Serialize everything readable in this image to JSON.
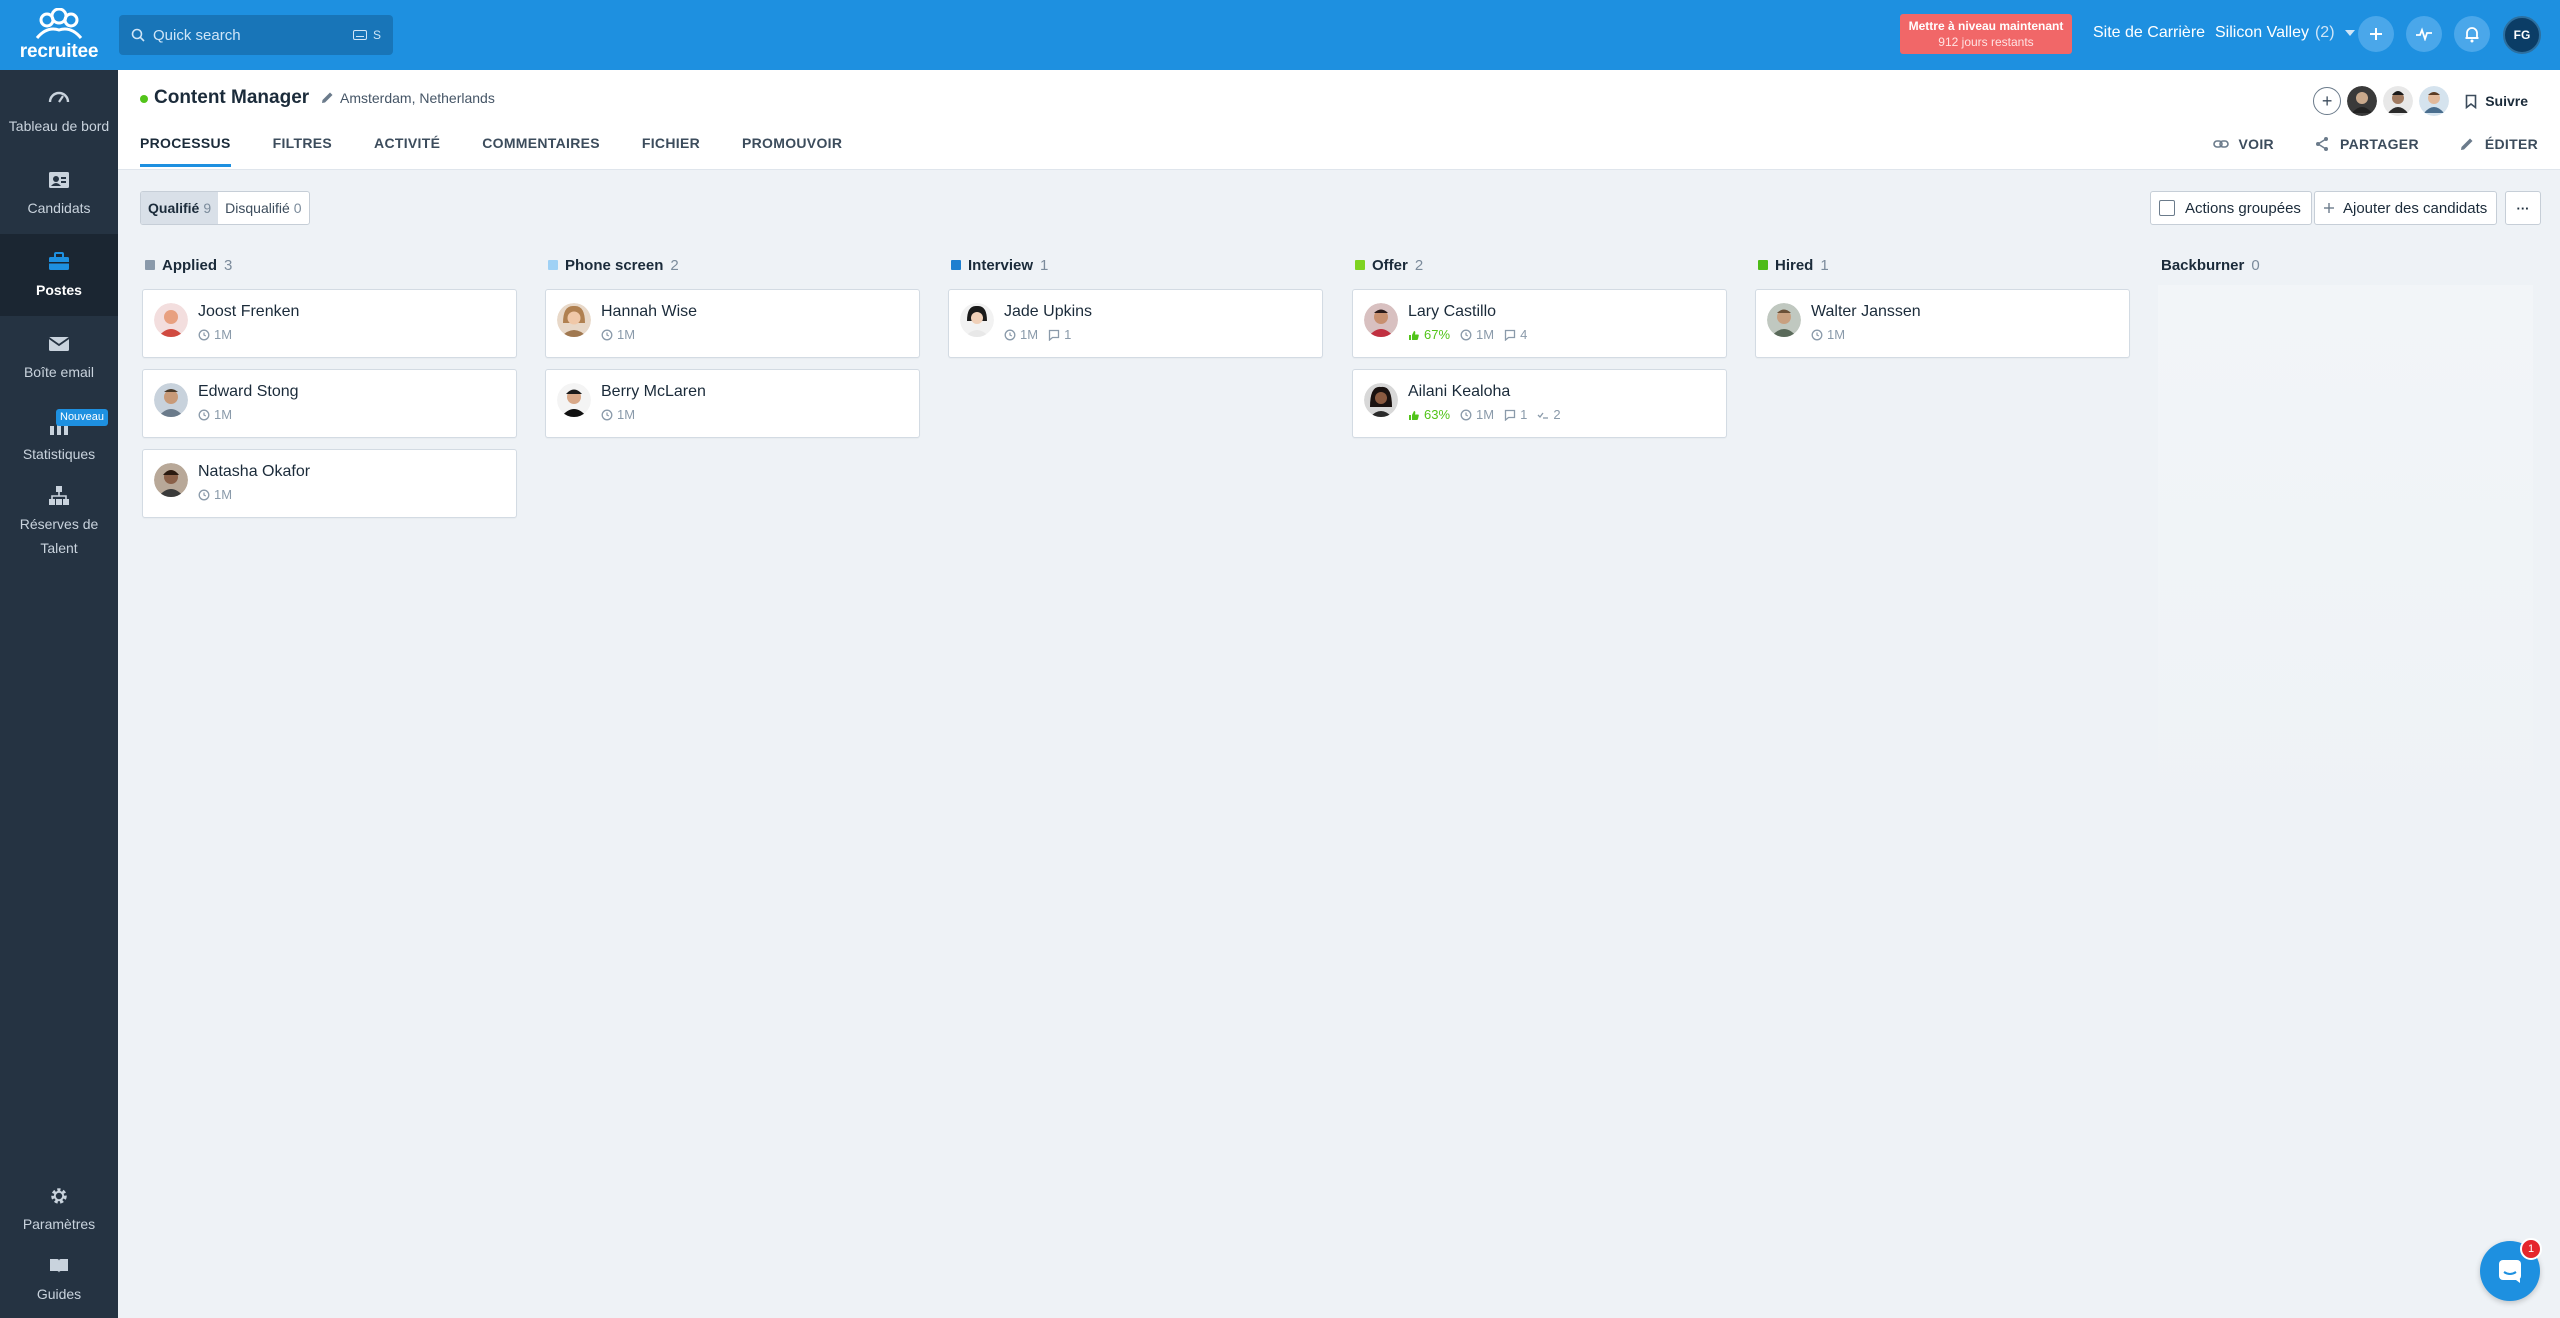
{
  "app": {
    "logo_text": "recruitee"
  },
  "topbar": {
    "search_placeholder": "Quick search",
    "search_shortcut": "S",
    "upgrade_title": "Mettre à niveau maintenant",
    "upgrade_sub": "912 jours restants",
    "career_site": "Site de Carrière",
    "company": "Silicon Valley",
    "company_count": "(2)",
    "user_initials": "FG"
  },
  "sidebar": {
    "items": [
      {
        "label": "Tableau de bord",
        "icon": "dashboard-gauge-icon"
      },
      {
        "label": "Candidats",
        "icon": "candidates-icon"
      },
      {
        "label": "Postes",
        "icon": "briefcase-icon"
      },
      {
        "label": "Boîte email",
        "icon": "mail-icon"
      },
      {
        "label": "Statistiques",
        "icon": "bar-chart-icon",
        "badge": "Nouveau"
      },
      {
        "label": "Réserves de Talent",
        "icon": "talent-pool-icon"
      }
    ],
    "bottom": [
      {
        "label": "Paramètres",
        "icon": "gear-icon"
      },
      {
        "label": "Guides",
        "icon": "book-icon"
      }
    ]
  },
  "job": {
    "title": "Content Manager",
    "location": "Amsterdam, Netherlands",
    "follow_label": "Suivre"
  },
  "tabs": [
    "PROCESSUS",
    "FILTRES",
    "ACTIVITÉ",
    "COMMENTAIRES",
    "FICHIER",
    "PROMOUVOIR"
  ],
  "header_actions": {
    "view": "VOIR",
    "share": "PARTAGER",
    "edit": "ÉDITER"
  },
  "toolbar": {
    "qualified_label": "Qualifié",
    "qualified_count": "9",
    "disqualified_label": "Disqualifié",
    "disqualified_count": "0",
    "group_actions": "Actions groupées",
    "add_candidates": "Ajouter des candidats",
    "more": "···"
  },
  "stages": [
    {
      "name": "Applied",
      "count": "3",
      "color": "#8a9aab",
      "cards": [
        {
          "name": "Joost Frenken",
          "time": "1M"
        },
        {
          "name": "Edward Stong",
          "time": "1M"
        },
        {
          "name": "Natasha Okafor",
          "time": "1M"
        }
      ]
    },
    {
      "name": "Phone screen",
      "count": "2",
      "color": "#9fd1f5",
      "cards": [
        {
          "name": "Hannah Wise",
          "time": "1M"
        },
        {
          "name": "Berry McLaren",
          "time": "1M"
        }
      ]
    },
    {
      "name": "Interview",
      "count": "1",
      "color": "#1e7fd0",
      "cards": [
        {
          "name": "Jade Upkins",
          "time": "1M",
          "comments": "1"
        }
      ]
    },
    {
      "name": "Offer",
      "count": "2",
      "color": "#7ed321",
      "cards": [
        {
          "name": "Lary Castillo",
          "score": "67%",
          "time": "1M",
          "comments": "4"
        },
        {
          "name": "Ailani Kealoha",
          "score": "63%",
          "time": "1M",
          "comments": "1",
          "tasks": "2"
        }
      ]
    },
    {
      "name": "Hired",
      "count": "1",
      "color": "#4cbb17",
      "cards": [
        {
          "name": "Walter Janssen",
          "time": "1M"
        }
      ]
    },
    {
      "name": "Backburner",
      "count": "0",
      "color": "",
      "cards": []
    }
  ],
  "chat": {
    "notifications": "1"
  }
}
